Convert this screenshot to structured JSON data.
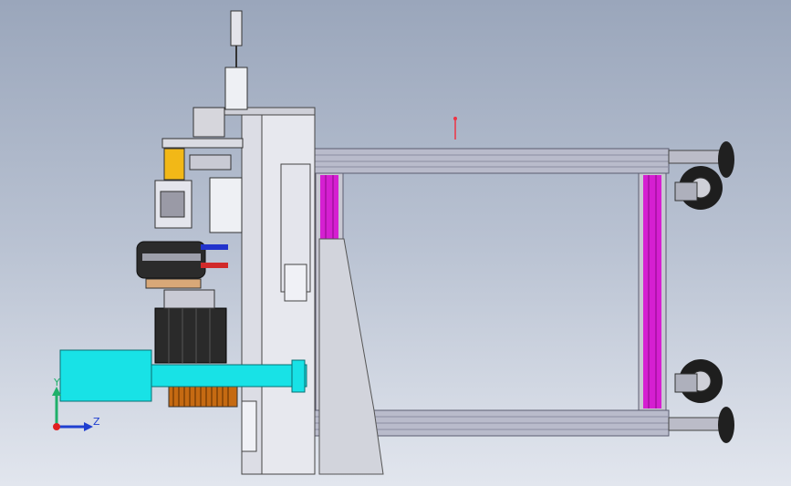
{
  "app": {
    "view": "cad-3d-viewport",
    "background_top": "#9aa6bb",
    "background_bottom": "#e2e6ee"
  },
  "triad": {
    "y_label": "Y",
    "z_label": "Z",
    "y_color": "#1fb06a",
    "z_color": "#1f3fd0",
    "origin_color": "#e02020"
  },
  "colors": {
    "frame": "#b4b6c6",
    "frame_dark": "#6e7084",
    "magenta_post": "#d51fd1",
    "cyan_block": "#18e2e6",
    "caster_black": "#202020",
    "yellow_part": "#f2b817",
    "motor_dark": "#2a2a2a"
  },
  "model_parts": [
    "frame-top-rail",
    "frame-bottom-rail",
    "left-post",
    "right-post",
    "caster-top",
    "caster-bottom",
    "cylinder-rod",
    "motor",
    "pulley",
    "cyan-block",
    "cyan-shaft",
    "pointer-marker",
    "gear",
    "side-panel"
  ]
}
